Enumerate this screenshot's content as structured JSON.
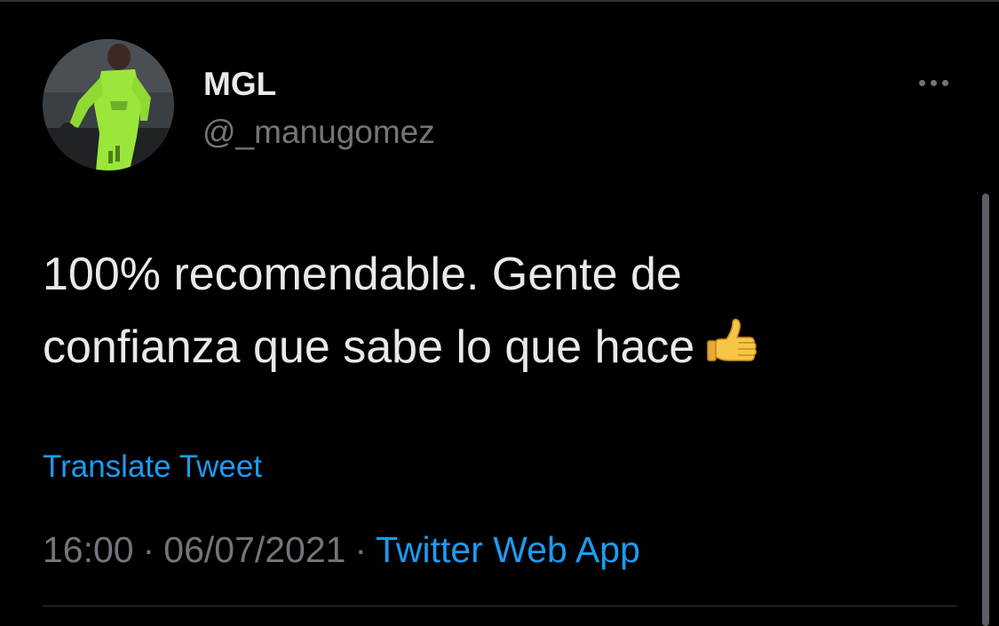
{
  "tweet": {
    "author": {
      "display_name": "MGL",
      "handle": "@_manugomez",
      "avatar_icon": "profile-photo"
    },
    "more_icon": "ellipsis-icon",
    "text_lines": [
      "100% recomendable. Gente de",
      "confianza que sabe lo que hace"
    ],
    "emoji": "thumbs-up-emoji",
    "translate_label": "Translate Tweet",
    "time": "16:00",
    "separator": "·",
    "date": "06/07/2021",
    "source": "Twitter Web App"
  },
  "colors": {
    "background": "#000000",
    "text_primary": "#e7e9ea",
    "text_secondary": "#71767b",
    "link": "#1d9bf0",
    "divider": "#2f3336"
  }
}
